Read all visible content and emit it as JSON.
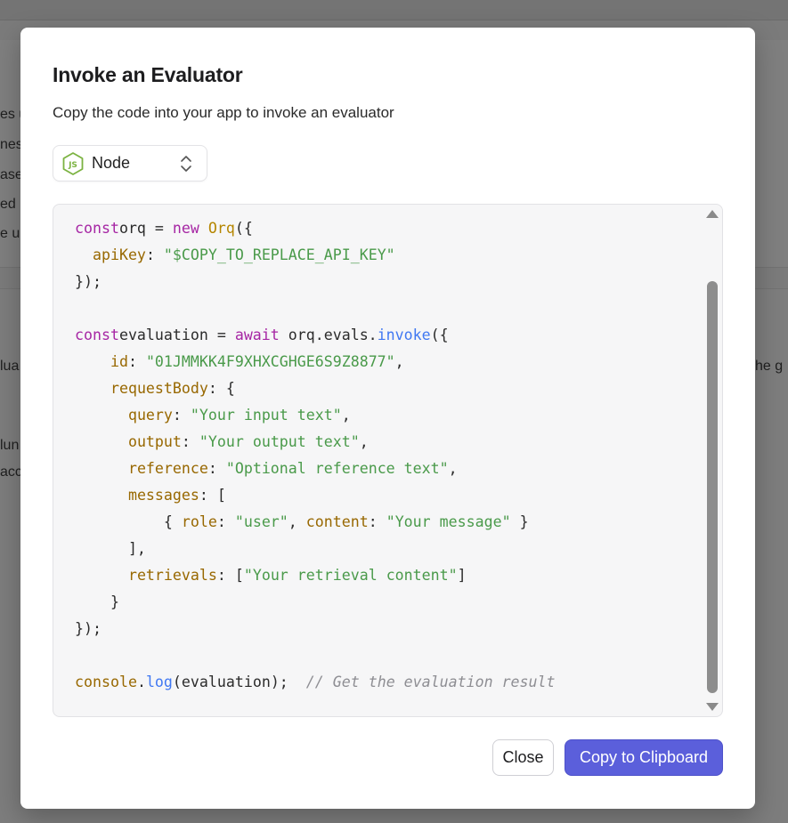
{
  "background": {
    "fragments": [
      "es u",
      "nes",
      "ase",
      "ed r",
      "e u",
      "lua",
      "he g",
      "lun",
      "acc"
    ]
  },
  "modal": {
    "title": "Invoke an Evaluator",
    "subtitle": "Copy the code into your app to invoke an evaluator",
    "language_select": {
      "value": "Node",
      "icon": "nodejs-icon"
    },
    "code": {
      "lines": [
        [
          [
            "kw",
            "const"
          ],
          [
            "",
            "orq = "
          ],
          [
            "kw",
            "new"
          ],
          [
            "",
            " "
          ],
          [
            "cls",
            "Orq"
          ],
          [
            "",
            "({"
          ]
        ],
        [
          [
            "",
            "  "
          ],
          [
            "prop",
            "apiKey"
          ],
          [
            "",
            ": "
          ],
          [
            "str",
            "\"$COPY_TO_REPLACE_API_KEY\""
          ]
        ],
        [
          [
            "",
            "});"
          ]
        ],
        [
          [
            "",
            ""
          ]
        ],
        [
          [
            "kw",
            "const"
          ],
          [
            "",
            "evaluation = "
          ],
          [
            "kw",
            "await"
          ],
          [
            "",
            " orq.evals."
          ],
          [
            "fn",
            "invoke"
          ],
          [
            "",
            "({"
          ]
        ],
        [
          [
            "",
            "    "
          ],
          [
            "prop",
            "id"
          ],
          [
            "",
            ": "
          ],
          [
            "str",
            "\"01JMMKK4F9XHXCGHGE6S9Z8877\""
          ],
          [
            "",
            ","
          ]
        ],
        [
          [
            "",
            "    "
          ],
          [
            "prop",
            "requestBody"
          ],
          [
            "",
            ": {"
          ]
        ],
        [
          [
            "",
            "      "
          ],
          [
            "prop",
            "query"
          ],
          [
            "",
            ": "
          ],
          [
            "str",
            "\"Your input text\""
          ],
          [
            "",
            ","
          ]
        ],
        [
          [
            "",
            "      "
          ],
          [
            "prop",
            "output"
          ],
          [
            "",
            ": "
          ],
          [
            "str",
            "\"Your output text\""
          ],
          [
            "",
            ","
          ]
        ],
        [
          [
            "",
            "      "
          ],
          [
            "prop",
            "reference"
          ],
          [
            "",
            ": "
          ],
          [
            "str",
            "\"Optional reference text\""
          ],
          [
            "",
            ","
          ]
        ],
        [
          [
            "",
            "      "
          ],
          [
            "prop",
            "messages"
          ],
          [
            "",
            ": ["
          ]
        ],
        [
          [
            "",
            "          { "
          ],
          [
            "prop",
            "role"
          ],
          [
            "",
            ": "
          ],
          [
            "str",
            "\"user\""
          ],
          [
            "",
            ", "
          ],
          [
            "prop",
            "content"
          ],
          [
            "",
            ": "
          ],
          [
            "str",
            "\"Your message\""
          ],
          [
            "",
            " }"
          ]
        ],
        [
          [
            "",
            "      ],"
          ]
        ],
        [
          [
            "",
            "      "
          ],
          [
            "prop",
            "retrievals"
          ],
          [
            "",
            ": ["
          ],
          [
            "str",
            "\"Your retrieval content\""
          ],
          [
            "",
            "]"
          ]
        ],
        [
          [
            "",
            "    }"
          ]
        ],
        [
          [
            "",
            "});"
          ]
        ],
        [
          [
            "",
            ""
          ]
        ],
        [
          [
            "prop",
            "console"
          ],
          [
            "",
            "."
          ],
          [
            "fn",
            "log"
          ],
          [
            "",
            "(evaluation);  "
          ],
          [
            "cmt",
            "// Get the evaluation result"
          ]
        ]
      ]
    },
    "buttons": {
      "close": "Close",
      "copy": "Copy to Clipboard"
    }
  }
}
